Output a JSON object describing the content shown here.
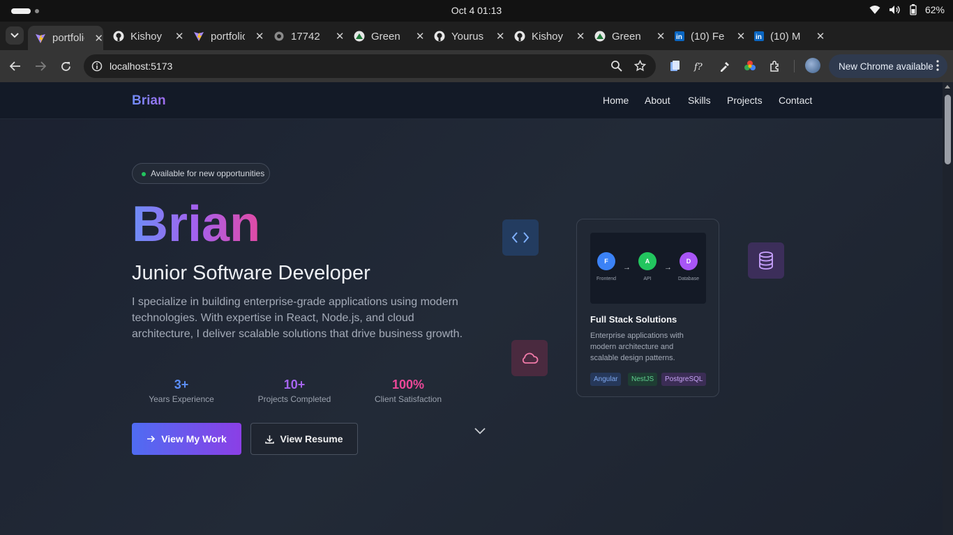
{
  "os": {
    "clock": "Oct 4  01:13",
    "battery": "62%"
  },
  "tabs": [
    {
      "title": "portfolio",
      "icon": "vite-icon",
      "active": true
    },
    {
      "title": "Kishoy",
      "icon": "github-icon"
    },
    {
      "title": "portfolio",
      "icon": "vite-icon"
    },
    {
      "title": "17742",
      "icon": "globe-icon"
    },
    {
      "title": "Green",
      "icon": "greenlake-icon"
    },
    {
      "title": "Yourus",
      "icon": "github-icon"
    },
    {
      "title": "Kishoy",
      "icon": "github-icon"
    },
    {
      "title": "Green",
      "icon": "greenlake-icon"
    },
    {
      "title": "(10) Fe",
      "icon": "linkedin-icon"
    },
    {
      "title": "(10) M",
      "icon": "linkedin-icon"
    }
  ],
  "toolbar": {
    "url": "localhost:5173",
    "new_chrome_label": "New Chrome available"
  },
  "site": {
    "brand": "Brian",
    "nav": [
      "Home",
      "About",
      "Skills",
      "Projects",
      "Contact"
    ],
    "badge": "Available for new opportunities",
    "hero_name": "Brian",
    "role": "Junior Software Developer",
    "description": "I specialize in building enterprise-grade applications using modern technologies. With expertise in React, Node.js, and cloud architecture, I deliver scalable solutions that drive business growth.",
    "stats": [
      {
        "value": "3+",
        "label": "Years Experience",
        "color": "#5b8df6"
      },
      {
        "value": "10+",
        "label": "Projects Completed",
        "color": "#a665f0"
      },
      {
        "value": "100%",
        "label": "Client Satisfaction",
        "color": "#ec4899"
      }
    ],
    "primary_button": "View My Work",
    "secondary_button": "View Resume"
  },
  "card": {
    "nodes": [
      {
        "letter": "F",
        "label": "Frontend",
        "color": "#3b82f6"
      },
      {
        "letter": "A",
        "label": "API",
        "color": "#22c55e"
      },
      {
        "letter": "D",
        "label": "Database",
        "color": "#a855f7"
      }
    ],
    "arrow": "→",
    "title": "Full Stack Solutions",
    "description": "Enterprise applications with modern architecture and scalable design patterns.",
    "chips": [
      "Angular",
      "NestJS",
      "PostgreSQL"
    ]
  },
  "colors": {
    "accent_blue": "#4f6cf2",
    "accent_purple": "#8b3fe6",
    "accent_pink": "#ec4899"
  }
}
